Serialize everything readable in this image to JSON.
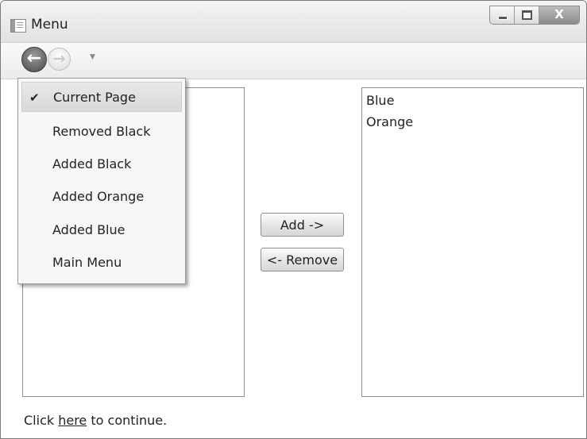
{
  "window": {
    "title": "Menu",
    "close_glyph": "X"
  },
  "navigation": {
    "back_glyph": "←",
    "forward_glyph": "→",
    "dropdown_glyph": "▼"
  },
  "history_menu": {
    "check_glyph": "✔",
    "items": [
      {
        "label": "Current Page",
        "checked": true
      },
      {
        "label": "Removed Black",
        "checked": false
      },
      {
        "label": "Added Black",
        "checked": false
      },
      {
        "label": "Added Orange",
        "checked": false
      },
      {
        "label": "Added Blue",
        "checked": false
      },
      {
        "label": "Main Menu",
        "checked": false
      }
    ]
  },
  "left_list": {
    "items": []
  },
  "right_list": {
    "items": [
      "Blue",
      "Orange"
    ]
  },
  "buttons": {
    "add_label": "Add ->",
    "remove_label": "<- Remove"
  },
  "status": {
    "prefix": "Click ",
    "link": "here",
    "suffix": " to continue."
  }
}
